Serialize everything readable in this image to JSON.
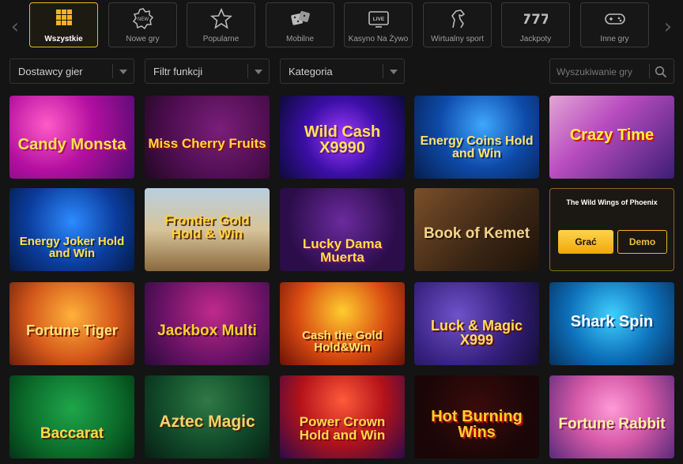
{
  "nav": {
    "prev_glyph": "‹",
    "next_glyph": "›",
    "categories": [
      {
        "label": "Wszystkie",
        "icon": "grid-icon",
        "active": true
      },
      {
        "label": "Nowe gry",
        "icon": "new-badge-icon",
        "active": false
      },
      {
        "label": "Popularne",
        "icon": "star-icon",
        "active": false
      },
      {
        "label": "Mobilne",
        "icon": "dice-icon",
        "active": false
      },
      {
        "label": "Kasyno Na Żywo",
        "icon": "live-tv-icon",
        "active": false
      },
      {
        "label": "Wirtualny sport",
        "icon": "horse-icon",
        "active": false
      },
      {
        "label": "Jackpoty",
        "icon": "sevens-icon",
        "active": false
      },
      {
        "label": "Inne gry",
        "icon": "gamepad-icon",
        "active": false
      }
    ]
  },
  "filters": {
    "providers": "Dostawcy gier",
    "features": "Filtr funkcji",
    "category": "Kategoria",
    "search_placeholder": "Wyszukiwanie gry"
  },
  "games": [
    {
      "title": "Candy Monsta"
    },
    {
      "title": "Miss Cherry Fruits"
    },
    {
      "title": "Wild Cash X9990"
    },
    {
      "title": "Energy Coins Hold and Win"
    },
    {
      "title": "Crazy Time"
    },
    {
      "title": "Energy Joker Hold and Win"
    },
    {
      "title": "Frontier Gold Hold & Win"
    },
    {
      "title": "Lucky Dama Muerta"
    },
    {
      "title": "Book of Kemet"
    },
    {
      "title": "The Wild Wings of Phoenix",
      "play": "Grać",
      "demo": "Demo"
    },
    {
      "title": "Fortune Tiger"
    },
    {
      "title": "Jackbox Multi"
    },
    {
      "title": "Cash the Gold Hold&Win"
    },
    {
      "title": "Luck & Magic X999"
    },
    {
      "title": "Shark Spin"
    },
    {
      "title": "Baccarat"
    },
    {
      "title": "Aztec Magic"
    },
    {
      "title": "Power Crown Hold and Win"
    },
    {
      "title": "Hot Burning Wins"
    },
    {
      "title": "Fortune Rabbit"
    }
  ],
  "colors": {
    "accent": "#f0b51e",
    "background": "#141414",
    "border": "#333333"
  }
}
